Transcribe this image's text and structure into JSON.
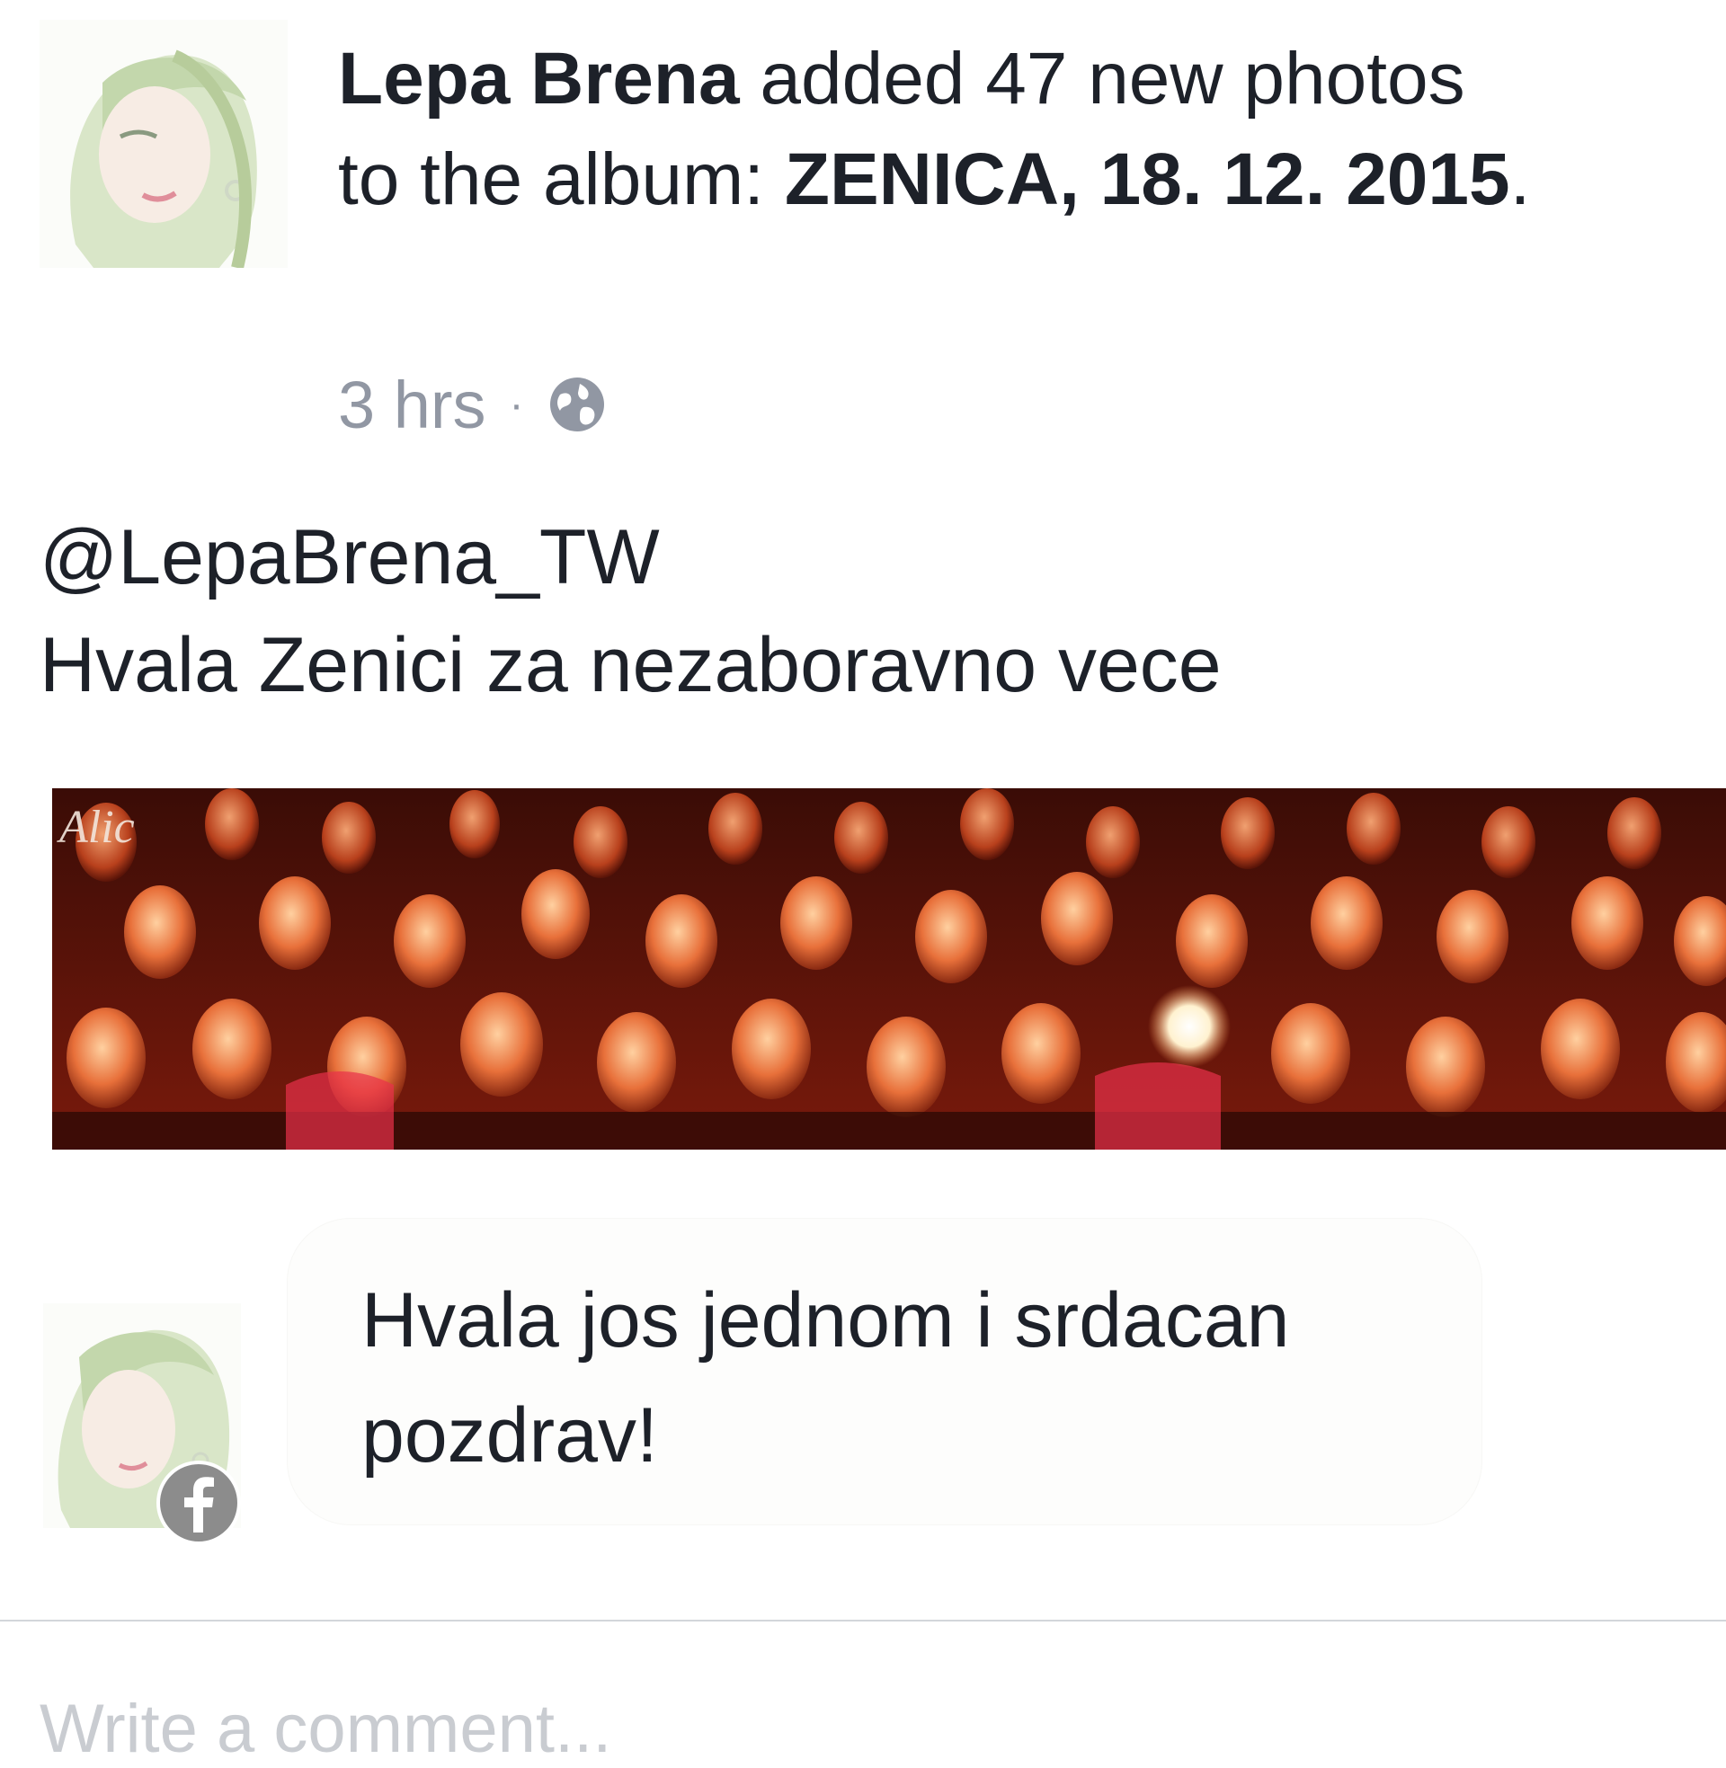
{
  "post": {
    "author": "Lepa Brena",
    "action_text": " added 47 new photos to the album: ",
    "album_title": "ZENICA, 18. 12. 2015",
    "album_suffix": ".",
    "time": "3 hrs",
    "separator": "·",
    "privacy_icon": "globe-icon",
    "body_lines": [
      "@LepaBrena_TW",
      "Hvala Zenici za nezaboravno vece"
    ],
    "photo_watermark": "Alic"
  },
  "comment": {
    "text": "Hvala jos jednom i srdacan pozdrav!",
    "badge_icon": "facebook-icon"
  },
  "composer": {
    "placeholder": "Write a comment..."
  },
  "colors": {
    "text": "#1d2129",
    "meta": "#9197a3",
    "divider": "#d3d6db",
    "badge": "#8c8c8c"
  }
}
